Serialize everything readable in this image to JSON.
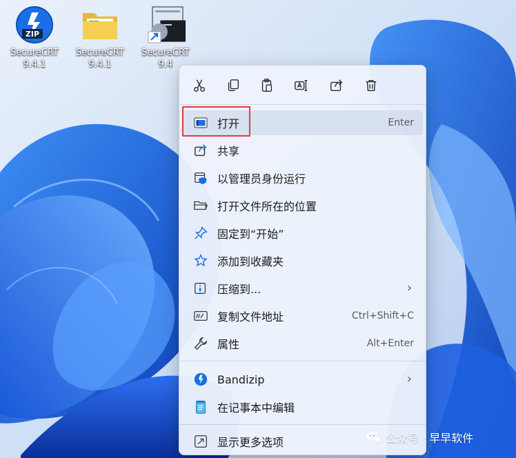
{
  "desktop": {
    "icons": [
      {
        "name_line1": "SecureCRT",
        "name_line2": "9.4.1",
        "icon": "zip-archive-icon"
      },
      {
        "name_line1": "SecureCRT",
        "name_line2": "9.4.1",
        "icon": "folder-icon"
      },
      {
        "name_line1": "SecureCRT",
        "name_line2": "9.4",
        "icon": "securecrt-shortcut-icon"
      }
    ]
  },
  "context_menu": {
    "toolbar": [
      {
        "icon": "cut-icon"
      },
      {
        "icon": "copy-icon"
      },
      {
        "icon": "paste-icon"
      },
      {
        "icon": "rename-icon"
      },
      {
        "icon": "share-icon"
      },
      {
        "icon": "delete-icon"
      }
    ],
    "items": [
      {
        "label": "打开",
        "shortcut": "Enter",
        "icon": "open-window-icon"
      },
      {
        "label": "共享",
        "shortcut": "",
        "icon": "share-icon"
      },
      {
        "label": "以管理员身份运行",
        "shortcut": "",
        "icon": "admin-shield-icon"
      },
      {
        "label": "打开文件所在的位置",
        "shortcut": "",
        "icon": "folder-open-icon"
      },
      {
        "label": "固定到“开始”",
        "shortcut": "",
        "icon": "pin-icon"
      },
      {
        "label": "添加到收藏夹",
        "shortcut": "",
        "icon": "star-icon"
      },
      {
        "label": "压缩到...",
        "shortcut": "",
        "icon": "compress-icon",
        "submenu": "›"
      },
      {
        "label": "复制文件地址",
        "shortcut": "Ctrl+Shift+C",
        "icon": "copy-path-icon"
      },
      {
        "label": "属性",
        "shortcut": "Alt+Enter",
        "icon": "wrench-icon"
      },
      {
        "label": "Bandizip",
        "shortcut": "",
        "icon": "bandizip-icon",
        "submenu": "›"
      },
      {
        "label": "在记事本中编辑",
        "shortcut": "",
        "icon": "notepad-icon"
      },
      {
        "label": "显示更多选项",
        "shortcut": "",
        "icon": "more-options-icon"
      }
    ]
  },
  "watermark": {
    "text": "公众号 · 早早软件"
  },
  "colors": {
    "highlight": "#e03c3c",
    "accent": "#0067c0"
  }
}
